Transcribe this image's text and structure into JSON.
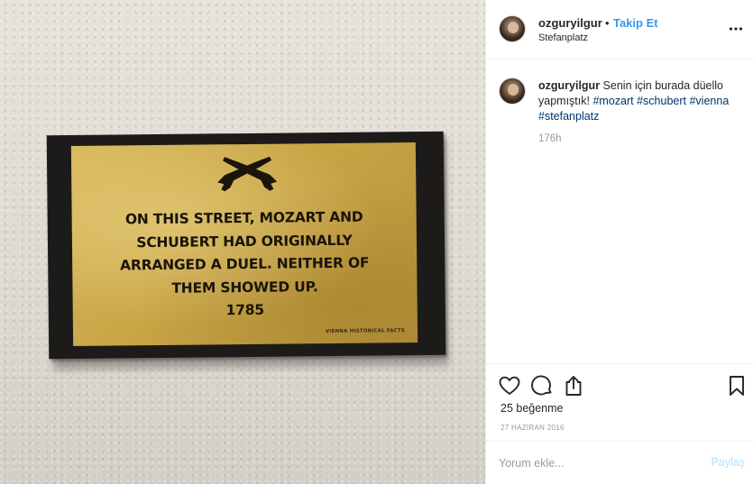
{
  "post": {
    "image": {
      "plaque_lines": [
        "ON THIS STREET, MOZART AND",
        "SCHUBERT HAD ORIGINALLY",
        "ARRANGED A DUEL. NEITHER OF",
        "THEM SHOWED UP."
      ],
      "plaque_year": "1785",
      "plaque_credit": "VIENNA HISTORICAL FACTS",
      "plaque_icon": "crossed-pistols-icon"
    }
  },
  "header": {
    "username": "ozguryilgur",
    "separator": "•",
    "follow_label": "Takip Et",
    "location": "Stefanplatz",
    "more_icon": "more-horizontal-icon"
  },
  "caption": {
    "username": "ozguryilgur",
    "text": "Senin için burada düello yapmıştık!",
    "hashtags": [
      "#mozart",
      "#schubert",
      "#vienna",
      "#stefanplatz"
    ],
    "time": "176h"
  },
  "actions": {
    "icons": [
      "heart-icon",
      "comment-bubble-icon",
      "share-icon",
      "bookmark-icon"
    ],
    "likes": "25 beğenme",
    "date": "27 HAZİRAN 2016"
  },
  "add_comment": {
    "placeholder": "Yorum ekle...",
    "post_label": "Paylaş"
  },
  "colors": {
    "link": "#3897f0",
    "hashtag": "#003569",
    "muted": "#999999",
    "post_disabled": "#b2dffc",
    "plaque_gold": "#c9a545"
  }
}
